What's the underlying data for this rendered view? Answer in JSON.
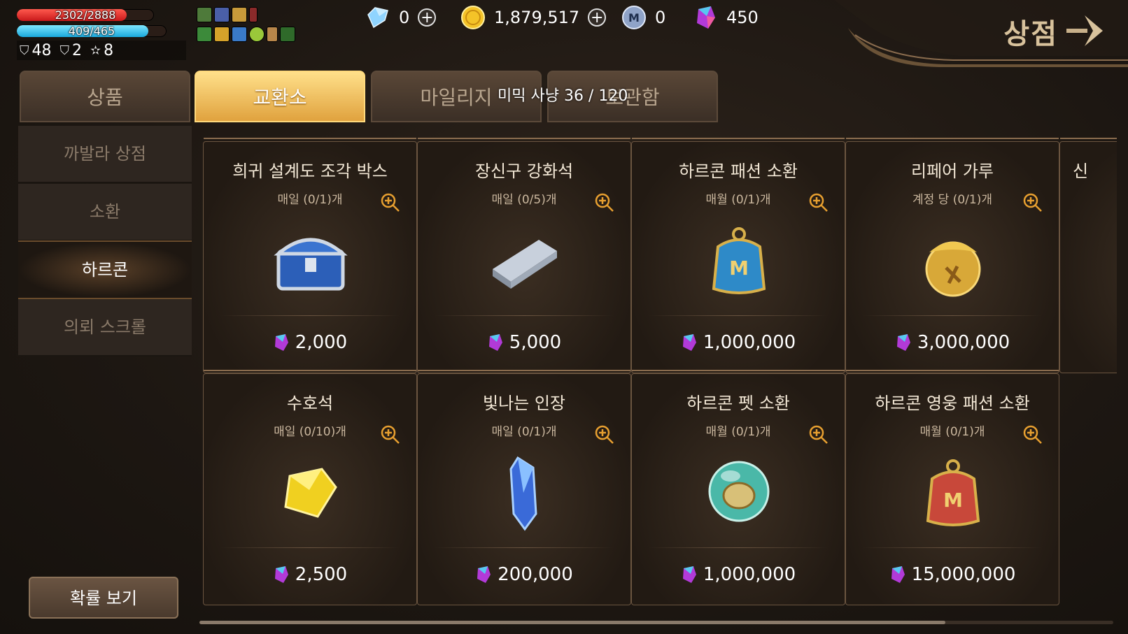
{
  "status": {
    "hp_text": "2302/2888",
    "hp_fraction": 0.8,
    "mp_text": "409/465",
    "mp_fraction": 0.88,
    "stat1": "48",
    "stat2": "2",
    "stat3": "8"
  },
  "currency": {
    "diamond": "0",
    "gold": "1,879,517",
    "mileage": "0",
    "mythic_gem": "450"
  },
  "header": {
    "title": "상점"
  },
  "tabs": [
    "상품",
    "교환소",
    "마일리지",
    "보관함"
  ],
  "active_tab": 1,
  "hunt_counter": "미믹 사냥 36 / 120",
  "sidebar": {
    "items": [
      "까발라 상점",
      "소환",
      "하르콘",
      "의뢰 스크롤"
    ],
    "active": 2,
    "prob_button": "확률 보기"
  },
  "cards": [
    {
      "name": "희귀 설계도 조각 박스",
      "limit": "매일 (0/1)개",
      "price": "2,000",
      "icon": "treasure-chest-icon"
    },
    {
      "name": "장신구 강화석",
      "limit": "매일 (0/5)개",
      "price": "5,000",
      "icon": "silver-ingot-icon"
    },
    {
      "name": "하르콘 패션 소환",
      "limit": "매월 (0/1)개",
      "price": "1,000,000",
      "icon": "fashion-bag-blue-icon"
    },
    {
      "name": "리페어 가루",
      "limit": "계정 당 (0/1)개",
      "price": "3,000,000",
      "icon": "repair-powder-bag-icon"
    },
    {
      "name": "수호석",
      "limit": "매일 (0/10)개",
      "price": "2,500",
      "icon": "yellow-gem-icon"
    },
    {
      "name": "빛나는 인장",
      "limit": "매일 (0/1)개",
      "price": "200,000",
      "icon": "blue-crystal-icon"
    },
    {
      "name": "하르콘 펫 소환",
      "limit": "매월 (0/1)개",
      "price": "1,000,000",
      "icon": "pet-orb-icon"
    },
    {
      "name": "하르콘 영웅 패션 소환",
      "limit": "매월 (0/1)개",
      "price": "15,000,000",
      "icon": "fashion-bag-red-icon"
    }
  ],
  "partial_card_name": "신",
  "colors": {
    "active_tab": "#e0a23e",
    "hp": "#c9181a",
    "mp": "#1aa8dc"
  }
}
